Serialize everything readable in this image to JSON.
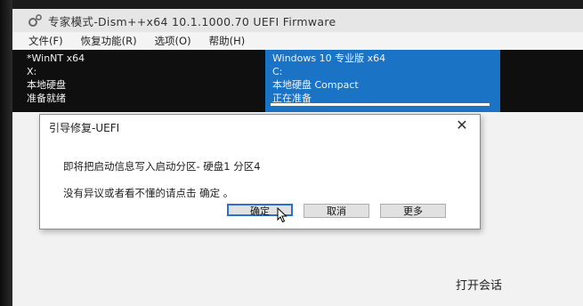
{
  "window": {
    "title": "专家模式-Dism++x64 10.1.1000.70 UEFI Firmware"
  },
  "menu": [
    {
      "label": "文件(F)"
    },
    {
      "label": "恢复功能(R)"
    },
    {
      "label": "选项(O)"
    },
    {
      "label": "帮助(H)"
    }
  ],
  "sessions": [
    {
      "name": "*WinNT x64",
      "drive": "X:",
      "type": "本地硬盘",
      "status": "准备就绪",
      "selected": false
    },
    {
      "name": "Windows 10 专业版 x64",
      "drive": "C:",
      "type": "本地硬盘 Compact",
      "status": "正在准备",
      "selected": true,
      "progress": 1.0
    }
  ],
  "background": {
    "open_session_label": "打开会话"
  },
  "dialog": {
    "title": "引导修复-UEFI",
    "close_icon": "close-icon",
    "message_line1": "即将把启动信息写入启动分区- 硬盘1 分区4",
    "message_line2": "没有异议或者看不懂的请点击 确定 。",
    "buttons": {
      "ok": "确定",
      "cancel": "取消",
      "more": "更多"
    }
  },
  "colors": {
    "selected_session_bg": "#1a73c4",
    "session_panel_bg": "#0f0f0f",
    "primary_button_border": "#2a6fd1"
  }
}
